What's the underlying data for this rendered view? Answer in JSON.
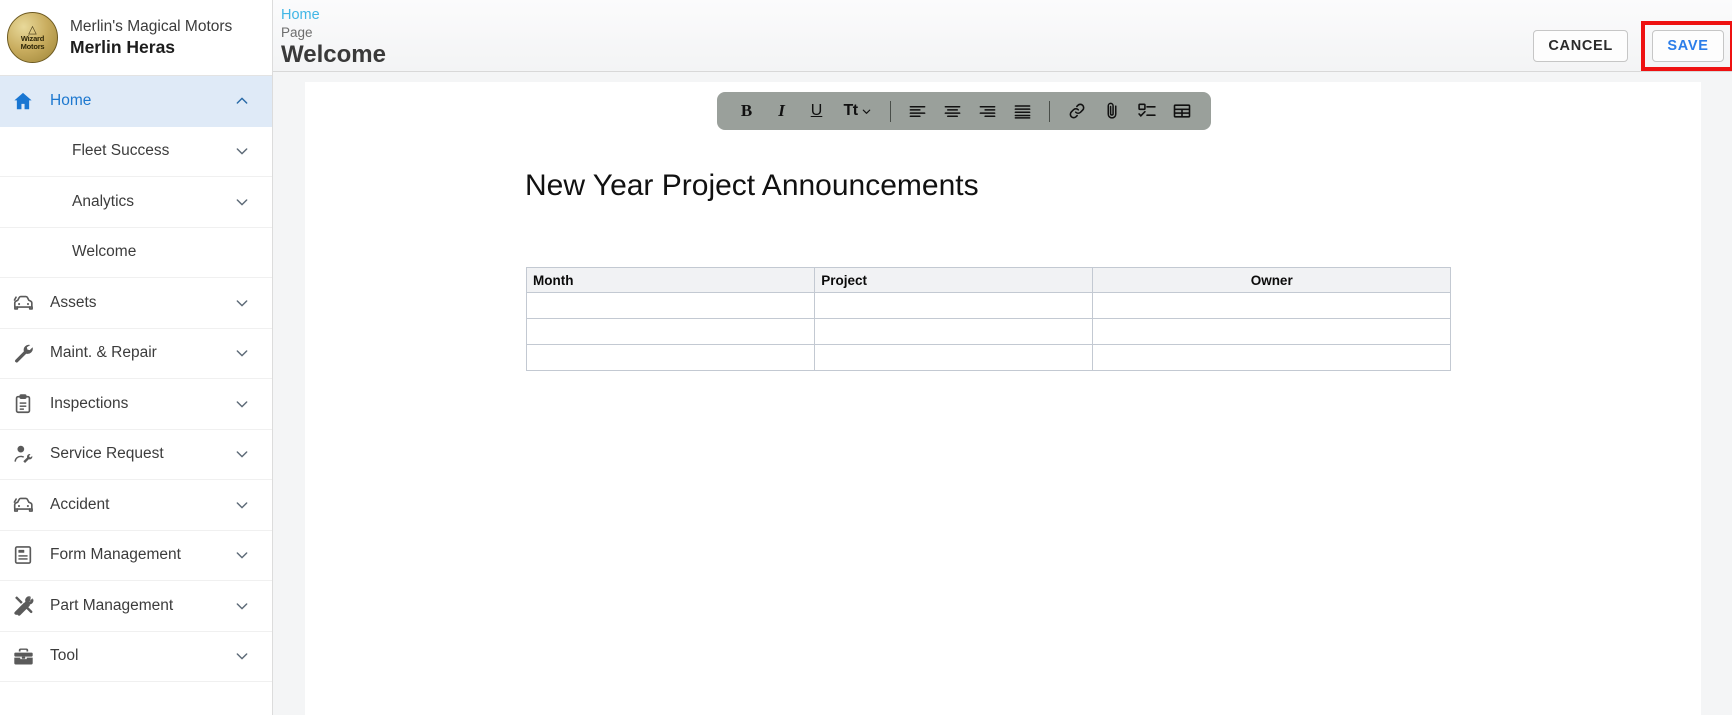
{
  "brand": {
    "logo_mark": "logo-wizard-icon",
    "logo_line1": "Wizard",
    "logo_line2": "Motors",
    "company": "Merlin's Magical Motors",
    "user": "Merlin Heras"
  },
  "sidebar": {
    "items": [
      {
        "label": "Home",
        "icon": "home-icon",
        "level": "top",
        "active": true,
        "chevron": "up",
        "has_icon": true
      },
      {
        "label": "Fleet Success",
        "icon": "",
        "level": "sub",
        "active": false,
        "chevron": "down",
        "has_icon": false
      },
      {
        "label": "Analytics",
        "icon": "",
        "level": "sub",
        "active": false,
        "chevron": "down",
        "has_icon": false
      },
      {
        "label": "Welcome",
        "icon": "",
        "level": "sub",
        "active": false,
        "chevron": "none",
        "has_icon": false
      },
      {
        "label": "Assets",
        "icon": "car-icon",
        "level": "top",
        "active": false,
        "chevron": "down",
        "has_icon": true
      },
      {
        "label": "Maint. & Repair",
        "icon": "wrench-icon",
        "level": "top",
        "active": false,
        "chevron": "down",
        "has_icon": true
      },
      {
        "label": "Inspections",
        "icon": "clipboard-icon",
        "level": "top",
        "active": false,
        "chevron": "down",
        "has_icon": true
      },
      {
        "label": "Service Request",
        "icon": "person-tool-icon",
        "level": "top",
        "active": false,
        "chevron": "down",
        "has_icon": true
      },
      {
        "label": "Accident",
        "icon": "car-crash-icon",
        "level": "top",
        "active": false,
        "chevron": "down",
        "has_icon": true
      },
      {
        "label": "Form Management",
        "icon": "form-icon",
        "level": "top",
        "active": false,
        "chevron": "down",
        "has_icon": true
      },
      {
        "label": "Part Management",
        "icon": "tools-cross-icon",
        "level": "top",
        "active": false,
        "chevron": "down",
        "has_icon": true
      },
      {
        "label": "Tool",
        "icon": "toolbox-icon",
        "level": "top",
        "active": false,
        "chevron": "down",
        "has_icon": true
      }
    ]
  },
  "header": {
    "breadcrumb_home": "Home",
    "breadcrumb_sub": "Page",
    "title": "Welcome",
    "cancel_label": "CANCEL",
    "save_label": "SAVE",
    "save_highlight_color": "#ee1111",
    "breadcrumb_link_color": "#41b6e6",
    "save_text_color": "#2b7de9"
  },
  "editor": {
    "toolbar_bg": "#9aa09b",
    "toolbar": [
      {
        "name": "bold-icon",
        "glyph": "B"
      },
      {
        "name": "italic-icon",
        "glyph": "I"
      },
      {
        "name": "underline-icon",
        "glyph": "U"
      },
      {
        "name": "font-size-icon",
        "glyph": "Tt"
      },
      {
        "name": "divider",
        "glyph": ""
      },
      {
        "name": "align-left-icon",
        "glyph": ""
      },
      {
        "name": "align-center-icon",
        "glyph": ""
      },
      {
        "name": "align-right-icon",
        "glyph": ""
      },
      {
        "name": "align-justify-icon",
        "glyph": ""
      },
      {
        "name": "divider",
        "glyph": ""
      },
      {
        "name": "link-icon",
        "glyph": ""
      },
      {
        "name": "attachment-icon",
        "glyph": ""
      },
      {
        "name": "checklist-icon",
        "glyph": ""
      },
      {
        "name": "table-icon",
        "glyph": ""
      }
    ],
    "document": {
      "title": "New Year Project Announcements",
      "table": {
        "headers": [
          "Month",
          "Project",
          "Owner"
        ],
        "header_align": [
          "left",
          "left",
          "center"
        ],
        "rows": [
          [
            "",
            "",
            ""
          ],
          [
            "",
            "",
            ""
          ],
          [
            "",
            "",
            ""
          ]
        ]
      }
    }
  }
}
